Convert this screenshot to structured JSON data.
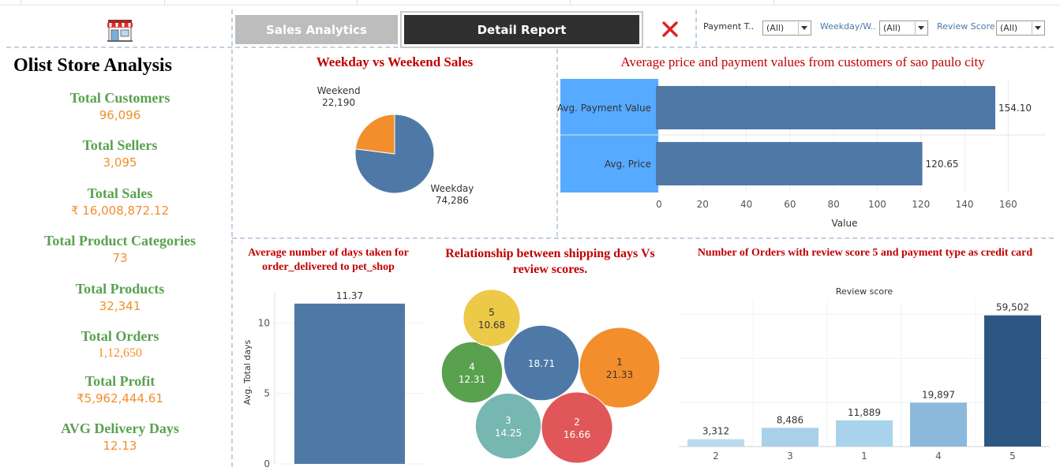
{
  "dashboard": {
    "title": "Olist Store Analysis",
    "logo_icon": "store-icon"
  },
  "nav": {
    "tab_sales": "Sales Analytics",
    "tab_detail": "Detail Report",
    "close_icon": "close-icon"
  },
  "filters": [
    {
      "label": "Payment T..",
      "value": "(All)"
    },
    {
      "label": "Weekday/W..",
      "value": "(All)"
    },
    {
      "label": "Review Score",
      "value": "(All)"
    }
  ],
  "kpis": [
    {
      "label": "Total Customers",
      "value": "96,096"
    },
    {
      "label": "Total Sellers",
      "value": "3,095"
    },
    {
      "label": "Total Sales",
      "value": "₹ 16,008,872.12"
    },
    {
      "label": "Total Product Categories",
      "value": "73"
    },
    {
      "label": "Total Products",
      "value": "32,341"
    },
    {
      "label": "Total Orders",
      "value": "1,12,650"
    },
    {
      "label": "Total Profit",
      "value": "₹5,962,444.61"
    },
    {
      "label": "AVG Delivery Days",
      "value": "12.13"
    }
  ],
  "colors": {
    "blue": "#4e79a7",
    "highlight": "#56aaff",
    "title_red": "#c00000",
    "kpi_green": "#59a14f",
    "kpi_orange": "#f28e2b"
  },
  "chart_data": [
    {
      "id": "weekday_weekend",
      "type": "pie",
      "title": "Weekday vs Weekend Sales",
      "labels": [
        "Weekday",
        "Weekend"
      ],
      "label_texts": [
        "74,286",
        "22,190"
      ],
      "values": [
        74286,
        22190
      ],
      "colors": [
        "#4e79a7",
        "#f28e2b"
      ]
    },
    {
      "id": "avg_price_payment",
      "type": "bar",
      "orientation": "horizontal",
      "title": "Average price and payment values from customers of sao paulo city",
      "categories": [
        "Avg. Payment Value",
        "Avg. Price"
      ],
      "values": [
        154.1,
        120.65
      ],
      "value_labels": [
        "154.10",
        "120.65"
      ],
      "xlabel": "Value",
      "xlim": [
        0,
        170
      ],
      "ticks": [
        0,
        20,
        40,
        60,
        80,
        100,
        120,
        140,
        160
      ],
      "grid": true
    },
    {
      "id": "pet_shop_days",
      "type": "bar",
      "title": "Average number of days taken for order_delivered to pet_shop",
      "categories": [
        ""
      ],
      "values": [
        11.37
      ],
      "value_labels": [
        "11.37"
      ],
      "ylabel": "Avg. Total days",
      "ylim": [
        0,
        12.2
      ],
      "ticks": [
        0,
        5,
        10
      ],
      "grid": true
    },
    {
      "id": "shipping_vs_review",
      "type": "scatter",
      "chart_subtype": "packed-bubble",
      "title": "Relationship between shipping days Vs review scores.",
      "points": [
        {
          "label": "1",
          "value": 21.33,
          "value_label": "21.33",
          "color": "#f28e2b"
        },
        {
          "label": "2",
          "value": 16.66,
          "value_label": "16.66",
          "color": "#e15759"
        },
        {
          "label": "",
          "value": 18.71,
          "value_label": "18.71",
          "color": "#4e79a7"
        },
        {
          "label": "3",
          "value": 14.25,
          "value_label": "14.25",
          "color": "#76b7b2"
        },
        {
          "label": "4",
          "value": 12.31,
          "value_label": "12.31",
          "color": "#59a14f"
        },
        {
          "label": "5",
          "value": 10.68,
          "value_label": "10.68",
          "color": "#edc948"
        }
      ]
    },
    {
      "id": "review5_credit_card",
      "type": "bar",
      "title": "Number of Orders with review score 5 and payment type as credit card",
      "xlabel": "Review score",
      "categories": [
        "2",
        "3",
        "1",
        "4",
        "5"
      ],
      "values": [
        3312,
        8486,
        11889,
        19897,
        59502
      ],
      "value_labels": [
        "3,312",
        "8,486",
        "11,889",
        "19,897",
        "59,502"
      ],
      "colors": [
        "#b9d9ee",
        "#a8d0ea",
        "#a9d3ec",
        "#8ab9db",
        "#2c5783"
      ],
      "ylim": [
        0,
        68000
      ],
      "grid": true
    }
  ]
}
